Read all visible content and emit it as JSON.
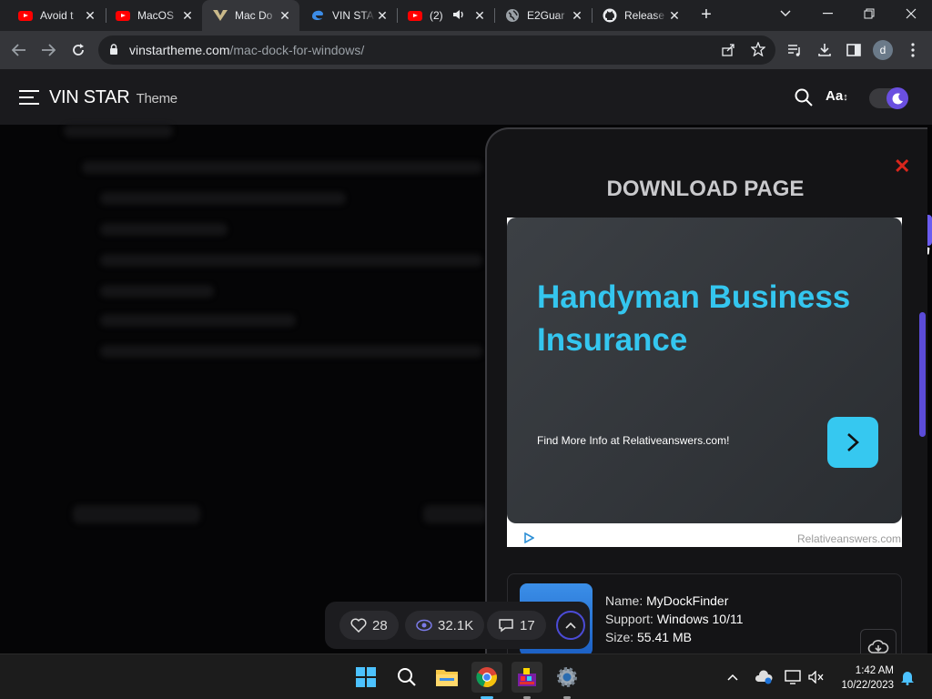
{
  "browser": {
    "tabs": [
      {
        "title": "Avoid t",
        "icon": "youtube-icon"
      },
      {
        "title": "MacOS",
        "icon": "youtube-icon"
      },
      {
        "title": "Mac Do",
        "icon": "vinstar-icon",
        "active": true
      },
      {
        "title": "VIN STA",
        "icon": "edge-icon"
      },
      {
        "title": "(2)",
        "icon": "youtube-icon",
        "audio": true
      },
      {
        "title": "E2Guar",
        "icon": "globe-icon"
      },
      {
        "title": "Release",
        "icon": "github-icon"
      }
    ],
    "url_domain": "vinstartheme.com",
    "url_path": "/mac-dock-for-windows/",
    "profile_initial": "d"
  },
  "site": {
    "brand_name": "VIN STAR",
    "brand_sub": "Theme",
    "font_button": "Aa"
  },
  "modal": {
    "title": "DOWNLOAD PAGE",
    "ad": {
      "headline": "Handyman Business Insurance",
      "sub": "Find More Info at Relativeanswers.com!",
      "domain": "Relativeanswers.com"
    },
    "file": {
      "name_label": "Name:",
      "name": "MyDockFinder",
      "support_label": "Support:",
      "support": "Windows 10/11",
      "size_label": "Size:",
      "size": "55.41 MB"
    }
  },
  "reactions": {
    "likes": "28",
    "views": "32.1K",
    "comments": "17"
  },
  "taskbar": {
    "time": "1:42 AM",
    "date": "10/22/2023"
  }
}
